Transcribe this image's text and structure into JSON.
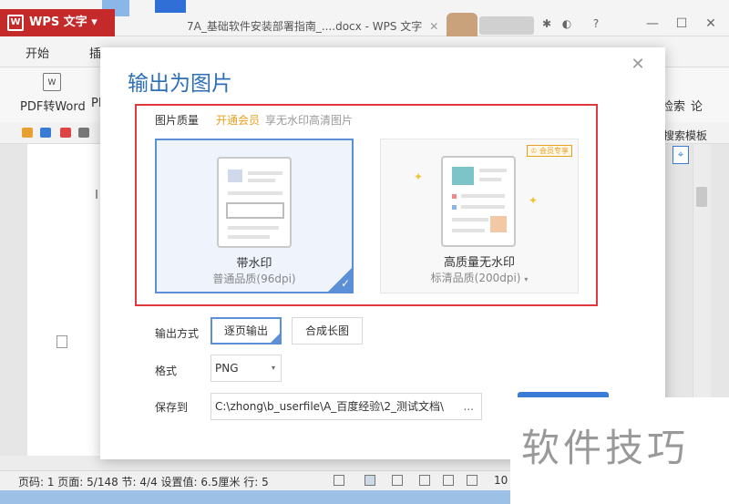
{
  "app": {
    "name": "WPS 文字",
    "document_title": "7A_基础软件安装部署指南_....docx - WPS 文字"
  },
  "menu": {
    "start": "开始",
    "insert_partial": "插"
  },
  "ribbon": {
    "pdf_to_word": "PDF转Word",
    "pdf_partial": "PD",
    "right_search": "检索",
    "right_lun": "论",
    "search_templates": "搜索模板"
  },
  "status": {
    "text": "页码: 1  页面: 5/148  节: 4/4  设置值: 6.5厘米  行: 5",
    "zoom": "10"
  },
  "dialog": {
    "title": "输出为图片",
    "quality": {
      "label": "图片质量",
      "vip_link": "开通会员",
      "vip_desc": "享无水印高清图片",
      "options": [
        {
          "name": "带水印",
          "sub": "普通品质(96dpi)",
          "selected": true
        },
        {
          "name": "高质量无水印",
          "sub": "标清品质(200dpi)",
          "badge": "会员专享",
          "selected": false
        }
      ]
    },
    "output_mode": {
      "label": "输出方式",
      "per_page": "逐页输出",
      "long_image": "合成长图",
      "selected": "逐页输出"
    },
    "format": {
      "label": "格式",
      "value": "PNG"
    },
    "save_to": {
      "label": "保存到",
      "path": "C:\\zhong\\b_userfile\\A_百度经验\\2_测试文档\\",
      "browse": "..."
    }
  },
  "watermark": {
    "text": "软件技巧"
  },
  "colors": {
    "accent": "#2c6fb7",
    "highlight_border": "#e0393e",
    "vip": "#e8a020",
    "app_red": "#c42a2a"
  }
}
